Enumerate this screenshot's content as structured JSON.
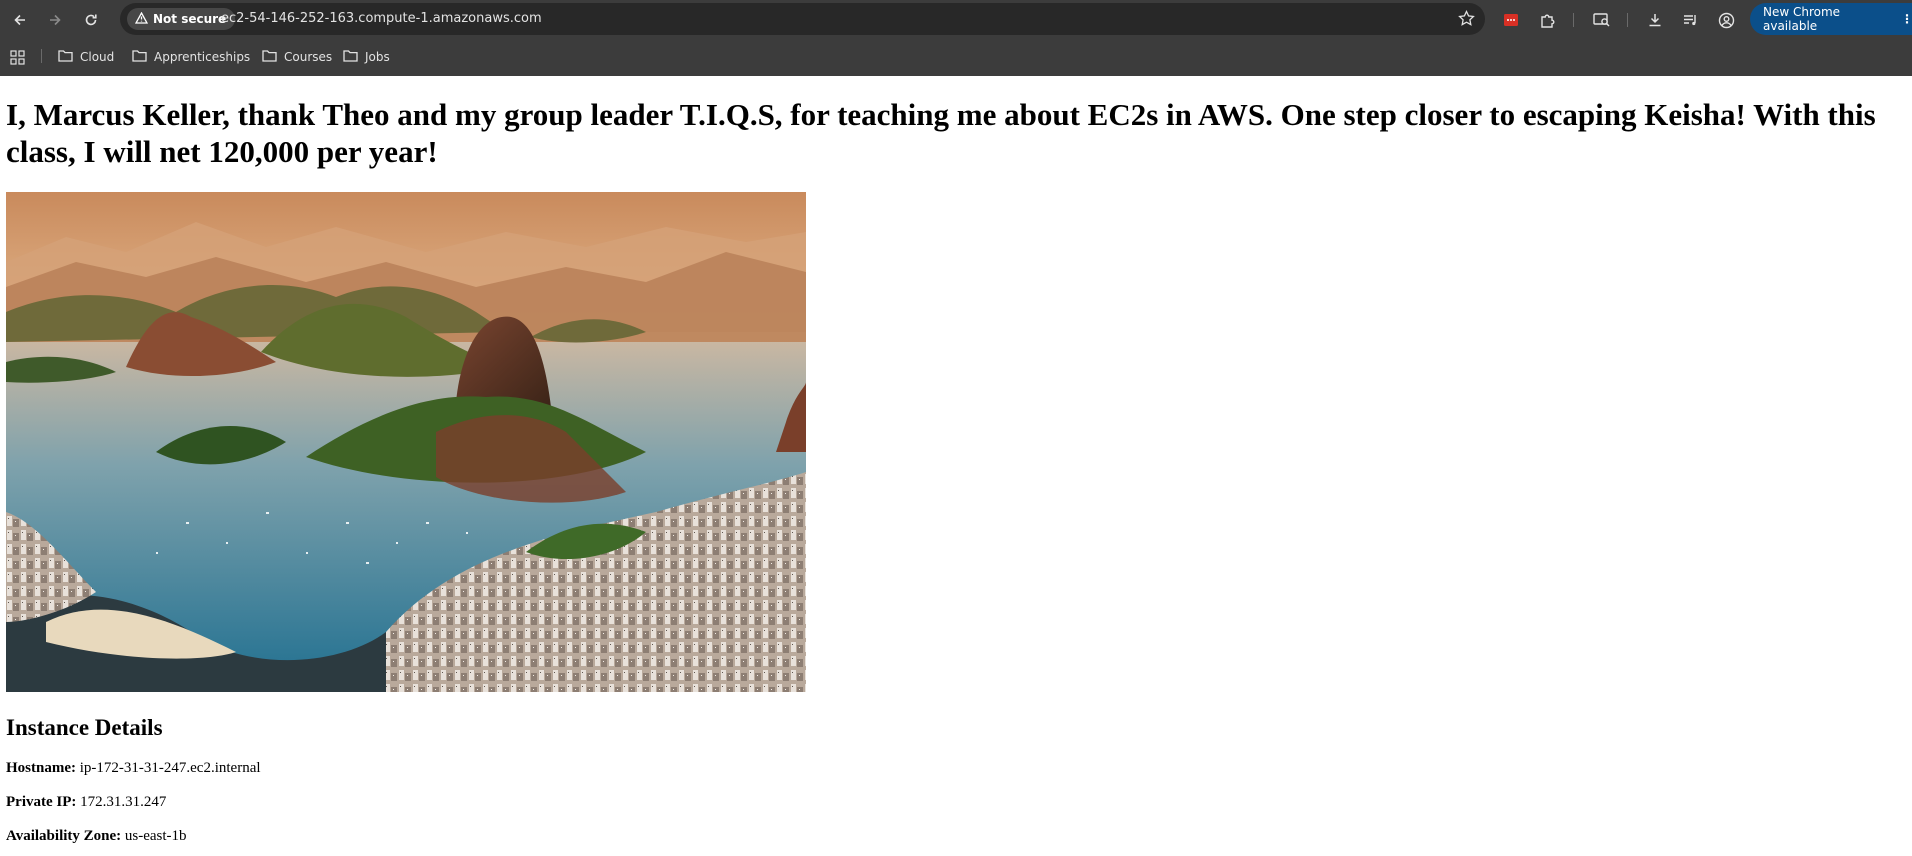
{
  "browser": {
    "security_label": "Not secure",
    "url": "ec2-54-146-252-163.compute-1.amazonaws.com",
    "update_label": "New Chrome available",
    "bookmarks": [
      "Cloud",
      "Apprenticeships",
      "Courses",
      "Jobs"
    ],
    "icons": [
      "back-icon",
      "forward-icon",
      "reload-icon",
      "warning-icon",
      "star-icon",
      "extension-red-icon",
      "puzzle-icon",
      "screen-search-icon",
      "download-icon",
      "media-icon",
      "profile-icon",
      "apps-grid-icon",
      "folder-icon",
      "kebab-icon"
    ]
  },
  "page": {
    "heading": "I, Marcus Keller, thank Theo and my group leader T.I.Q.S, for teaching me about EC2s in AWS. One step closer to escaping Keisha! With this class, I will net 120,000 per year!",
    "image_alt": "Rio de Janeiro bay with Sugarloaf Mountain",
    "section_title": "Instance Details",
    "details": [
      {
        "label": "Hostname:",
        "value": "ip-172-31-31-247.ec2.internal"
      },
      {
        "label": "Private IP:",
        "value": "172.31.31.247"
      },
      {
        "label": "Availability Zone:",
        "value": "us-east-1b"
      }
    ]
  },
  "colors": {
    "chrome_bg": "#3c3c3c",
    "omnibox_bg": "#282828",
    "update_blue": "#0b4f8a",
    "page_bg": "#ffffff"
  }
}
